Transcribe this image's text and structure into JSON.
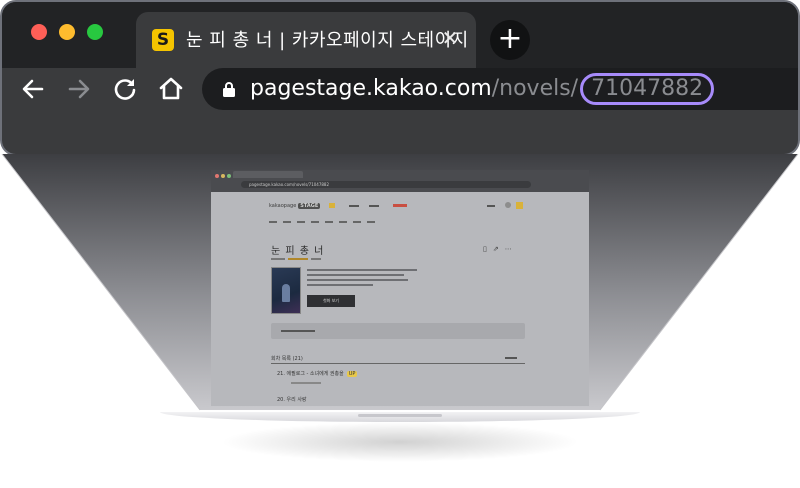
{
  "browser": {
    "tab": {
      "favicon_letter": "S",
      "title": "눈 피 총 너 | 카카오페이지 스테이지",
      "close_glyph": "✕"
    },
    "new_tab_glyph": "+",
    "url": {
      "domain": "pagestage.kakao.com",
      "path": "/novels/",
      "highlighted_id": "71047882",
      "highlight_color": "#a78bfa"
    },
    "nav_icons": [
      "back-arrow-icon",
      "forward-arrow-icon",
      "reload-icon",
      "home-icon",
      "lock-icon"
    ]
  },
  "mini_page": {
    "url": "pagestage.kakao.com/novels/71047882",
    "logo": "kakaopage",
    "logo_badge": "STAGE",
    "novel_title": "눈 피 총 너",
    "read_button": "첫화 보기",
    "episode_list_label": "회차 목록 (21)",
    "episodes": [
      {
        "number": "21.",
        "title": "에필로그 - 소녀에게 권총을",
        "badge": "UP"
      },
      {
        "number": "20.",
        "title": "우리 사랑"
      }
    ]
  },
  "colors": {
    "chrome_dark": "#222325",
    "toolbar": "#3a3b3d",
    "url_field": "#1c1d1f",
    "favicon": "#f5c400"
  }
}
